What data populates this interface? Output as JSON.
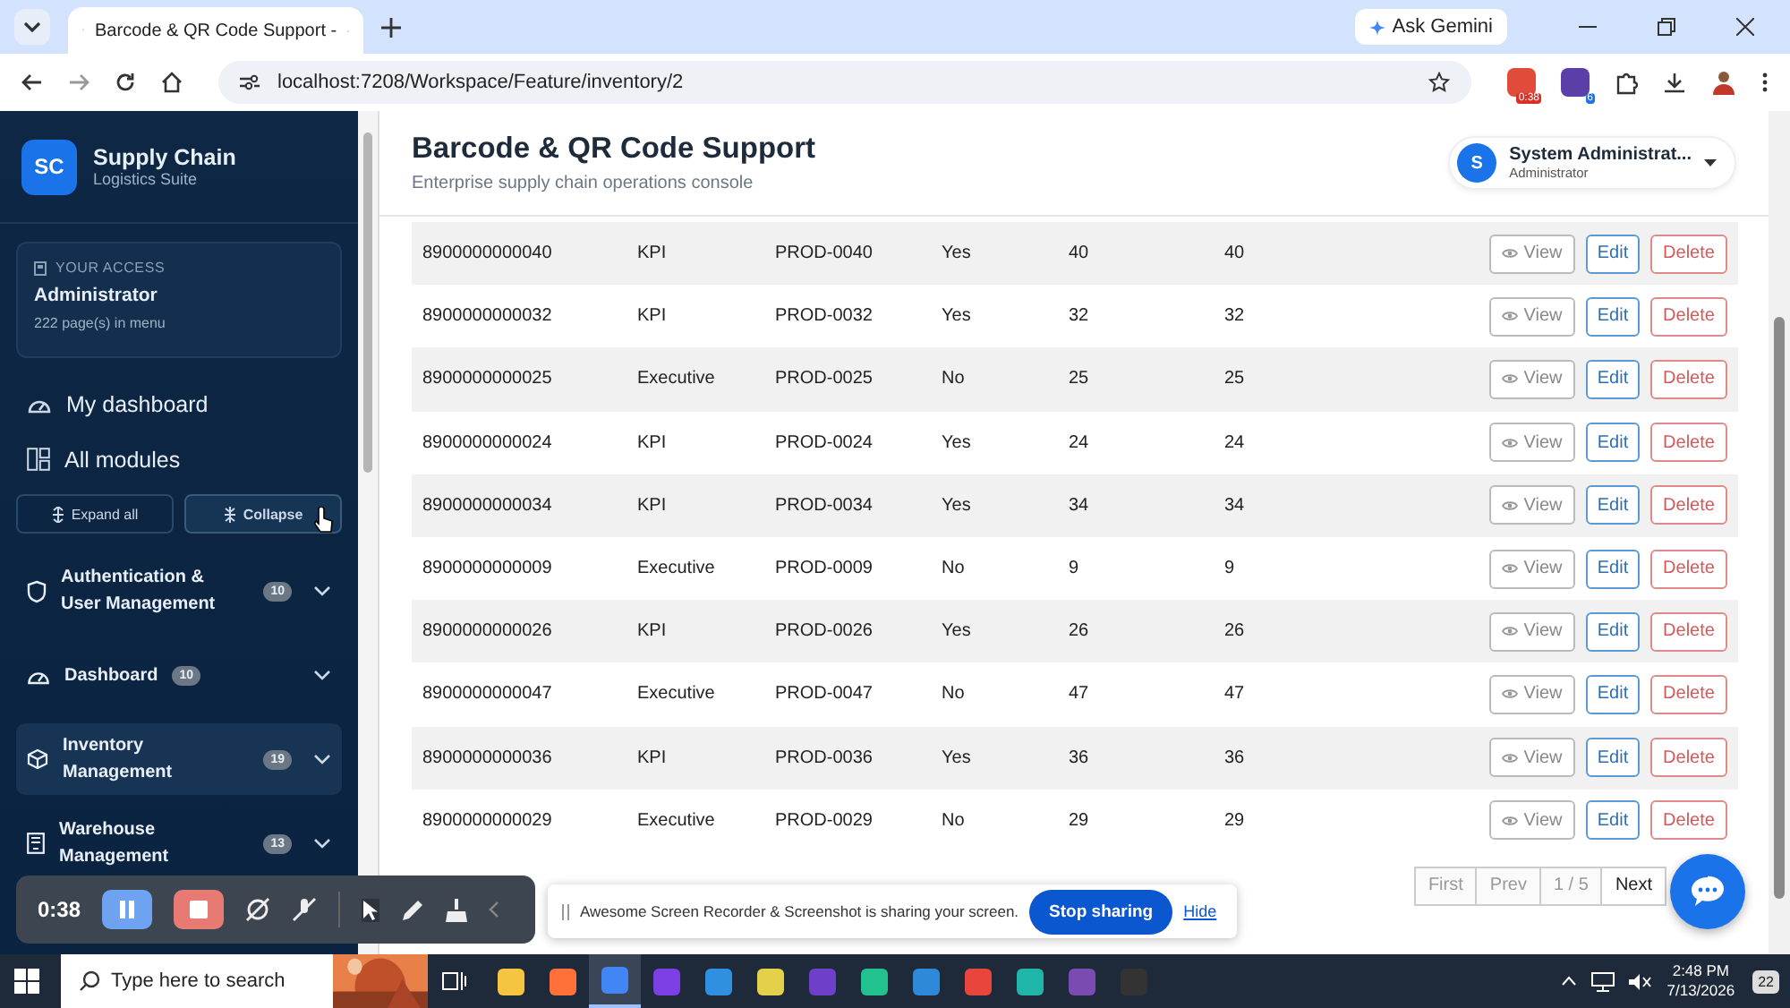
{
  "browser": {
    "tab_title": "Barcode & QR Code Support -",
    "url": "localhost:7208/Workspace/Feature/inventory/2",
    "ask_gemini": "Ask Gemini",
    "extension_badges": [
      "0:38",
      "6"
    ]
  },
  "sidebar": {
    "logo": "SC",
    "brand": "Supply Chain",
    "brand_subtitle": "Logistics Suite",
    "access": {
      "label": "YOUR ACCESS",
      "role": "Administrator",
      "pages": "222 page(s) in menu"
    },
    "links": [
      {
        "kind": "dashboard",
        "label": "My dashboard"
      },
      {
        "kind": "modules",
        "label": "All modules"
      }
    ],
    "tree_buttons": [
      {
        "kind": "expand",
        "label": "Expand all"
      },
      {
        "kind": "collapse",
        "label": "Collapse"
      }
    ],
    "groups": [
      {
        "kind": "shield",
        "label": "Authentication & User Management",
        "count": "10",
        "selected": false
      },
      {
        "kind": "dashboard",
        "label": "Dashboard",
        "count": "10",
        "selected": false
      },
      {
        "kind": "box",
        "label": "Inventory Management",
        "count": "19",
        "selected": true
      },
      {
        "kind": "building",
        "label": "Warehouse Management",
        "count": "13",
        "selected": false
      }
    ]
  },
  "header": {
    "title": "Barcode & QR Code Support",
    "subtitle": "Enterprise supply chain operations console",
    "user": {
      "initial": "S",
      "name": "System Administrat...",
      "role": "Administrator"
    }
  },
  "table": {
    "rows": [
      {
        "cells": [
          "8900000000040",
          "KPI",
          "PROD-0040",
          "Yes",
          "40",
          "40"
        ],
        "actions": [
          "View",
          "Edit",
          "Delete"
        ]
      },
      {
        "cells": [
          "8900000000032",
          "KPI",
          "PROD-0032",
          "Yes",
          "32",
          "32"
        ],
        "actions": [
          "View",
          "Edit",
          "Delete"
        ]
      },
      {
        "cells": [
          "8900000000025",
          "Executive",
          "PROD-0025",
          "No",
          "25",
          "25"
        ],
        "actions": [
          "View",
          "Edit",
          "Delete"
        ]
      },
      {
        "cells": [
          "8900000000024",
          "KPI",
          "PROD-0024",
          "Yes",
          "24",
          "24"
        ],
        "actions": [
          "View",
          "Edit",
          "Delete"
        ]
      },
      {
        "cells": [
          "8900000000034",
          "KPI",
          "PROD-0034",
          "Yes",
          "34",
          "34"
        ],
        "actions": [
          "View",
          "Edit",
          "Delete"
        ]
      },
      {
        "cells": [
          "8900000000009",
          "Executive",
          "PROD-0009",
          "No",
          "9",
          "9"
        ],
        "actions": [
          "View",
          "Edit",
          "Delete"
        ]
      },
      {
        "cells": [
          "8900000000026",
          "KPI",
          "PROD-0026",
          "Yes",
          "26",
          "26"
        ],
        "actions": [
          "View",
          "Edit",
          "Delete"
        ]
      },
      {
        "cells": [
          "8900000000047",
          "Executive",
          "PROD-0047",
          "No",
          "47",
          "47"
        ],
        "actions": [
          "View",
          "Edit",
          "Delete"
        ]
      },
      {
        "cells": [
          "8900000000036",
          "KPI",
          "PROD-0036",
          "Yes",
          "36",
          "36"
        ],
        "actions": [
          "View",
          "Edit",
          "Delete"
        ]
      },
      {
        "cells": [
          "8900000000029",
          "Executive",
          "PROD-0029",
          "No",
          "29",
          "29"
        ],
        "actions": [
          "View",
          "Edit",
          "Delete"
        ]
      }
    ]
  },
  "pager": [
    {
      "label": "First",
      "disabled": true
    },
    {
      "label": "Prev",
      "disabled": true
    },
    {
      "label": "1 / 5",
      "disabled": true
    },
    {
      "label": "Next",
      "disabled": false
    }
  ],
  "recorder": {
    "time": "0:38"
  },
  "share_banner": {
    "text": "Awesome Screen Recorder & Screenshot is sharing your screen.",
    "stop": "Stop sharing",
    "hide": "Hide"
  },
  "taskbar": {
    "search_placeholder": "Type here to search",
    "time": "2:48 PM",
    "date": "7/13/2026",
    "notifications": "22"
  }
}
